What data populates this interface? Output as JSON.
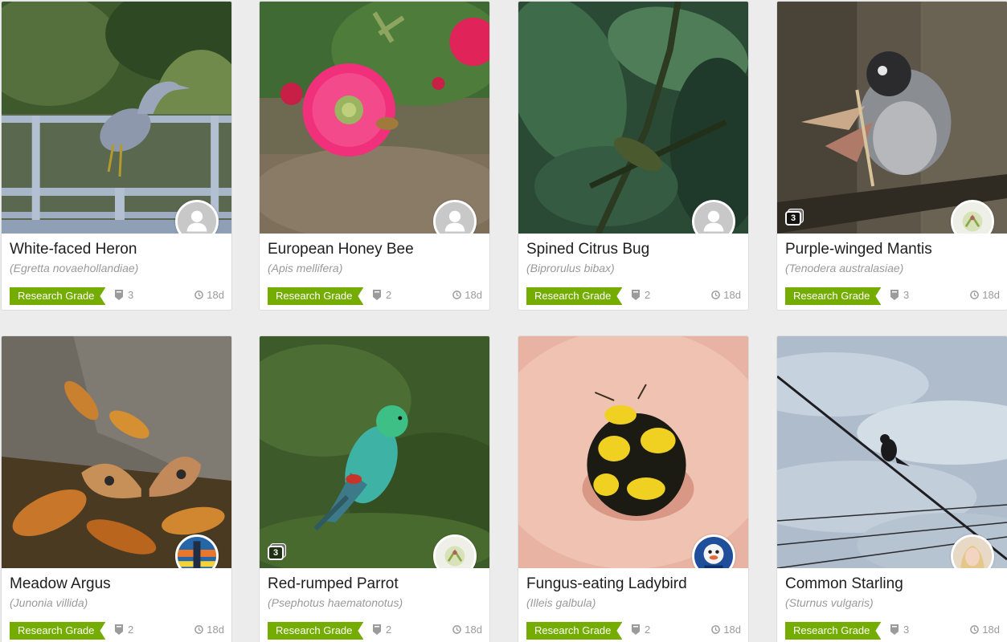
{
  "observations": [
    {
      "common_name": "White-faced Heron",
      "scientific_name": "(Egretta novaehollandiae)",
      "quality": "Research Grade",
      "identifications": "3",
      "age": "18d",
      "avatar": "default-user-icon",
      "photo_count": ""
    },
    {
      "common_name": "European Honey Bee",
      "scientific_name": "(Apis mellifera)",
      "quality": "Research Grade",
      "identifications": "2",
      "age": "18d",
      "avatar": "default-user-icon",
      "photo_count": ""
    },
    {
      "common_name": "Spined Citrus Bug",
      "scientific_name": "(Biprorulus bibax)",
      "quality": "Research Grade",
      "identifications": "2",
      "age": "18d",
      "avatar": "default-user-icon",
      "photo_count": ""
    },
    {
      "common_name": "Purple-winged Mantis",
      "scientific_name": "(Tenodera australasiae)",
      "quality": "Research Grade",
      "identifications": "3",
      "age": "18d",
      "avatar": "user-photo-avatar",
      "photo_count": "3"
    },
    {
      "common_name": "Meadow Argus",
      "scientific_name": "(Junonia villida)",
      "quality": "Research Grade",
      "identifications": "2",
      "age": "18d",
      "avatar": "user-photo-avatar",
      "photo_count": ""
    },
    {
      "common_name": "Red-rumped Parrot",
      "scientific_name": "(Psephotus haematonotus)",
      "quality": "Research Grade",
      "identifications": "2",
      "age": "18d",
      "avatar": "user-photo-avatar",
      "photo_count": "3"
    },
    {
      "common_name": "Fungus-eating Ladybird",
      "scientific_name": "(Illeis galbula)",
      "quality": "Research Grade",
      "identifications": "2",
      "age": "18d",
      "avatar": "user-photo-avatar",
      "photo_count": ""
    },
    {
      "common_name": "Common Starling",
      "scientific_name": "(Sturnus vulgaris)",
      "quality": "Research Grade",
      "identifications": "3",
      "age": "18d",
      "avatar": "user-photo-avatar",
      "photo_count": ""
    }
  ],
  "colors": {
    "research_grade": "#74ac00",
    "meta_text": "#9b9b9b",
    "background": "#ececec"
  }
}
